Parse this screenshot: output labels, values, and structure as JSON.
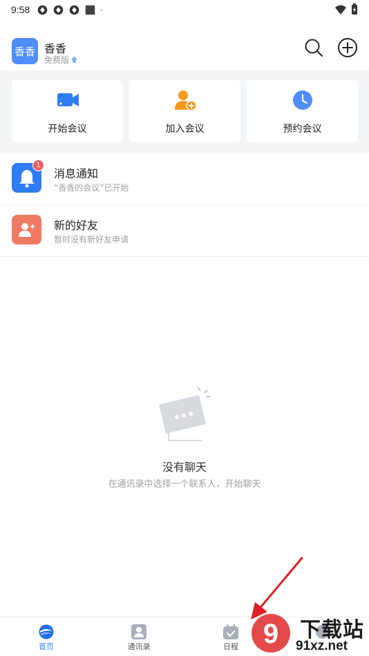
{
  "status_bar": {
    "time": "9:58"
  },
  "header": {
    "avatar_text": "香香",
    "user_name": "香香",
    "plan": "免费版"
  },
  "quick_actions": [
    {
      "label": "开始会议",
      "icon": "video-camera-icon",
      "color": "#2e7cf6"
    },
    {
      "label": "加入会议",
      "icon": "add-person-icon",
      "color": "#f59a1e"
    },
    {
      "label": "预约会议",
      "icon": "clock-icon",
      "color": "#4f8dfa"
    }
  ],
  "list": [
    {
      "title": "消息通知",
      "subtitle": "“香香的会议”已开始",
      "icon": "bell-icon",
      "color": "#2e7cf6",
      "badge": "1"
    },
    {
      "title": "新的好友",
      "subtitle": "暂时没有新好友申请",
      "icon": "add-friend-icon",
      "color": "#ef7a62"
    }
  ],
  "empty_state": {
    "title": "没有聊天",
    "subtitle": "在通讯录中选择一个联系人，开始聊天"
  },
  "bottom_nav": [
    {
      "label": "首页",
      "icon": "home-icon",
      "active": true
    },
    {
      "label": "通讯录",
      "icon": "contacts-icon",
      "active": false
    },
    {
      "label": "日程",
      "icon": "calendar-icon",
      "active": false
    },
    {
      "label": "",
      "icon": "me-icon",
      "active": false
    }
  ],
  "watermark": {
    "text": "下载站",
    "domain": "91xz.net",
    "number": "9"
  },
  "colors": {
    "accent": "#2e7cf6",
    "panel_bg": "#f4f5f7",
    "badge": "#f35c5c",
    "annotation": "#e02020"
  }
}
